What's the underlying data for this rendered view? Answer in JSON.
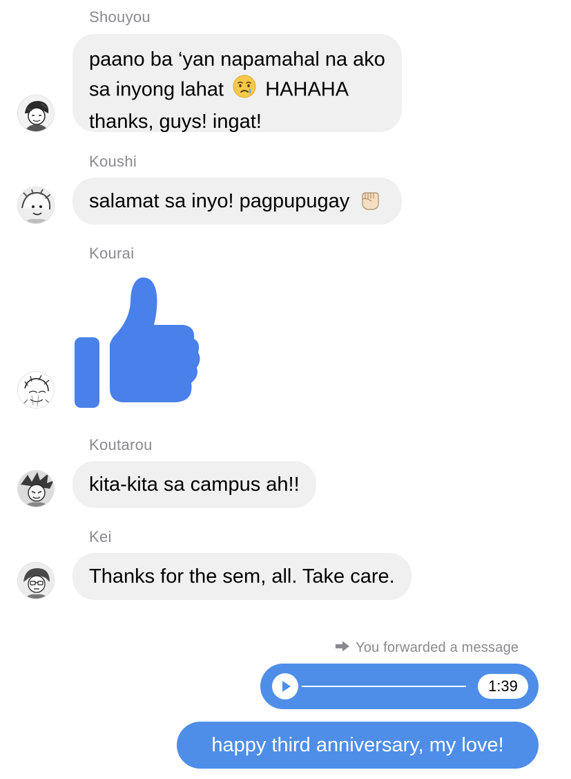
{
  "messages": [
    {
      "sender": "Shouyou",
      "text_line1_pre": "paano ba ‘yan napamahal na ako",
      "text_line2_pre": "sa inyong lahat",
      "emoji1": "crying-face",
      "text_line2_post": "HAHAHA",
      "text_line3": "thanks, guys! ingat!"
    },
    {
      "sender": "Koushi",
      "text": "salamat sa inyo! pagpupugay",
      "emoji1": "raised-fist"
    },
    {
      "sender": "Kourai",
      "sticker": "thumbs-up"
    },
    {
      "sender": "Koutarou",
      "text": "kita-kita sa campus ah!!"
    },
    {
      "sender": "Kei",
      "text": "Thanks for the sem, all. Take care."
    }
  ],
  "forwarded": {
    "label": "You forwarded a message",
    "icon": "forward-arrow-icon",
    "voice_duration": "1:39"
  },
  "outgoing": {
    "text": "happy third anniversary, my love!"
  },
  "colors": {
    "outgoing_bubble": "#4f8ee8",
    "incoming_bubble": "#f0f0f0",
    "sender_name": "#8a8a8e",
    "thumbs_up": "#4a80ea"
  }
}
